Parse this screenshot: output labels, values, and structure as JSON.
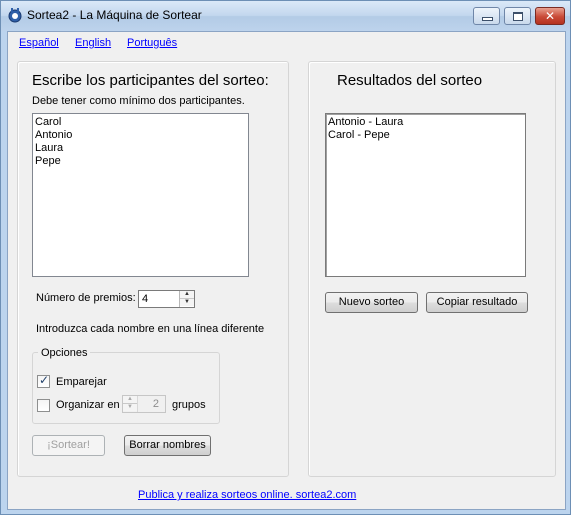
{
  "window": {
    "title": "Sortea2 - La Máquina de Sortear"
  },
  "languages": [
    "Español",
    "English",
    "Português"
  ],
  "participants": {
    "heading": "Escribe los participantes del sorteo:",
    "hint": "Debe tener como mínimo dos participantes.",
    "names": [
      "Carol",
      "Antonio",
      "Laura",
      "Pepe"
    ],
    "prizes_label": "Número de premios:",
    "prizes_value": "4",
    "line_hint": "Introduzca cada nombre en una línea diferente"
  },
  "options": {
    "legend": "Opciones",
    "pair_label": "Emparejar",
    "pair_checked": true,
    "organize_label": "Organizar en",
    "organize_checked": false,
    "groups_value": "2",
    "groups_label": "grupos"
  },
  "actions": {
    "draw_label": "¡Sortear!",
    "clear_label": "Borrar nombres"
  },
  "results": {
    "heading": "Resultados del sorteo",
    "lines": [
      "Antonio - Laura",
      "Carol - Pepe"
    ],
    "new_draw_label": "Nuevo sorteo",
    "copy_label": "Copiar resultado"
  },
  "footer": {
    "link_text": "Publica y realiza sorteos online.  sortea2.com"
  }
}
